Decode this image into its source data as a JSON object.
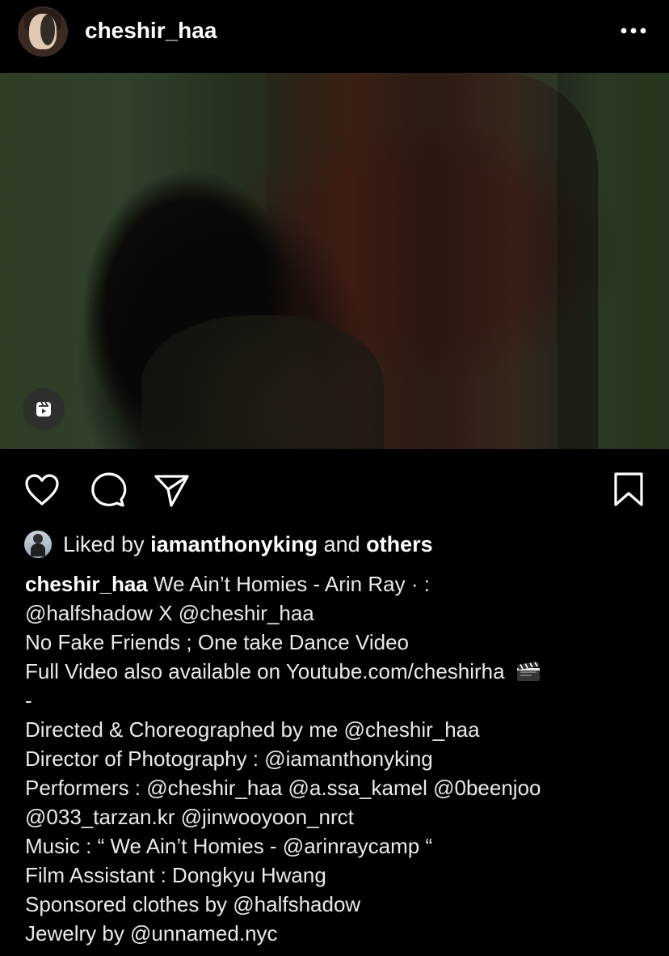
{
  "header": {
    "username": "cheshir_haa",
    "more_icon": "more-horizontal-icon"
  },
  "media": {
    "type": "video",
    "reel_icon": "reels-icon"
  },
  "actions": {
    "like_icon": "heart-icon",
    "comment_icon": "comment-icon",
    "share_icon": "send-icon",
    "save_icon": "bookmark-icon"
  },
  "likes": {
    "prefix": "Liked by ",
    "user": "iamanthonyking",
    "middle": " and ",
    "others": "others"
  },
  "caption": {
    "username": "cheshir_haa",
    "line1_text": " We Ain’t Homies - Arin Ray · :",
    "line2": "@halfshadow X @cheshir_haa",
    "line3": "No Fake Friends ; One take Dance Video",
    "line4_text": "Full Video also available on Youtube.com/cheshirha",
    "line4_icon": "clapper-board-icon",
    "line5": "-",
    "line6": "Directed & Choreographed by me @cheshir_haa",
    "line7": "Director of Photography : @iamanthonyking",
    "line8": "Performers : @cheshir_haa @a.ssa_kamel @0beenjoo",
    "line9": "@033_tarzan.kr @jinwooyoon_nrct",
    "line10": "Music : “ We Ain’t Homies - @arinraycamp “",
    "line11": "Film Assistant : Dongkyu Hwang",
    "line12": "Sponsored clothes by @halfshadow",
    "line13": "Jewelry by @unnamed.nyc"
  }
}
